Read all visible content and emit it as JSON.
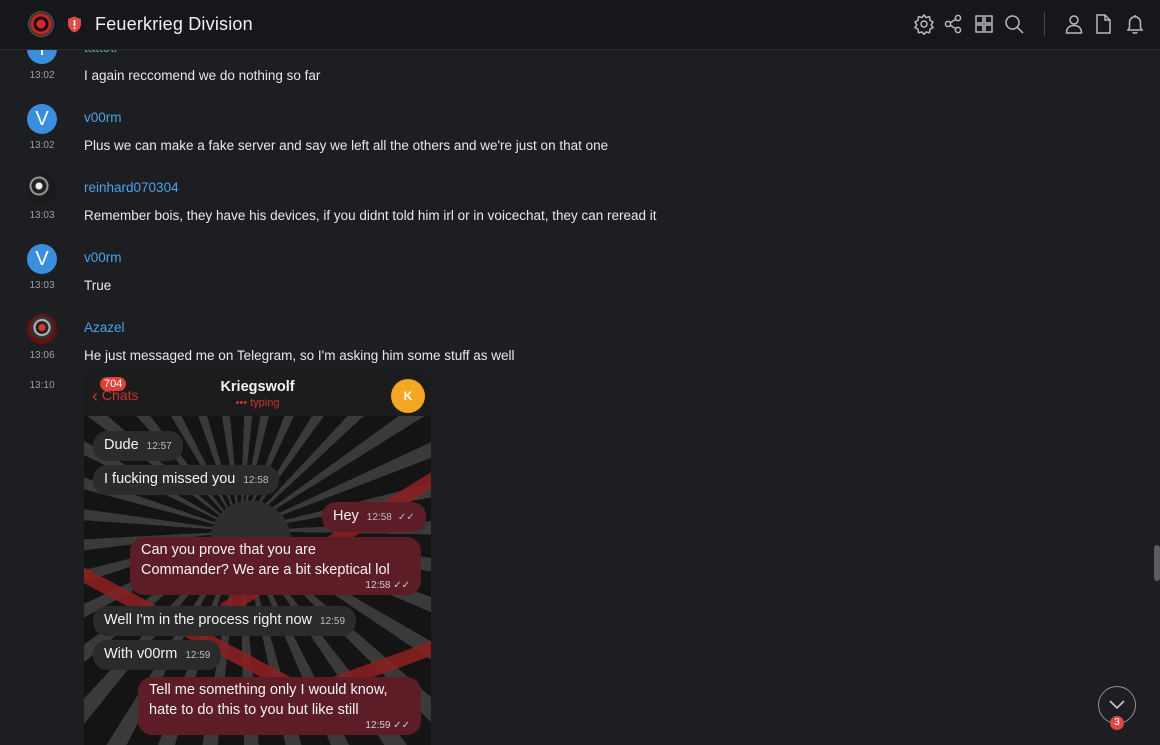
{
  "header": {
    "server_name": "Feuerkrieg Division"
  },
  "icons": {
    "server": "server-avatar-icon",
    "badge": "shield-alert-icon",
    "settings": "gear-icon",
    "share": "share-icon",
    "grid": "grid-icon",
    "search": "search-icon",
    "members": "user-icon",
    "files": "file-icon",
    "notifications": "bell-icon",
    "scroll_down": "chevron-down-icon"
  },
  "messages": [
    {
      "author": "tattoti",
      "avatar": "T",
      "time": "13:02",
      "text": "I again reccomend we do nothing so far"
    },
    {
      "author": "v00rm",
      "avatar": "V",
      "time": "13:02",
      "text": "Plus we can make a fake server and say we left all the others and we're just on that one"
    },
    {
      "author": "reinhard070304",
      "avatar": "",
      "time": "13:03",
      "text": "Remember bois, they have his devices, if you didnt told him irl or in voicechat, they can reread it"
    },
    {
      "author": "v00rm",
      "avatar": "V",
      "time": "13:03",
      "text": "True"
    },
    {
      "author": "Azazel",
      "avatar": "",
      "time": "13:06",
      "text": "He just messaged me on Telegram, so I'm asking him some stuff as well"
    },
    {
      "author": "",
      "avatar": "",
      "time": "13:10",
      "text": ""
    }
  ],
  "attachment": {
    "back_label": "Chats",
    "unread_count": "704",
    "contact_name": "Kriegswolf",
    "status": "typing",
    "contact_initial": "K",
    "bubbles": [
      {
        "text": "Dude",
        "time": "12:57",
        "dir": "in"
      },
      {
        "text": "I fucking missed you",
        "time": "12:58",
        "dir": "in"
      },
      {
        "text": "Hey",
        "time": "12:58",
        "dir": "out"
      },
      {
        "text": "Can you prove that you are Commander? We are a bit skeptical lol",
        "line1": "Can you prove that you are",
        "line2": "Commander? We are a bit skeptical lol",
        "time": "12:58",
        "dir": "out"
      },
      {
        "text": "Well I'm in the process right now",
        "time": "12:59",
        "dir": "in"
      },
      {
        "text": "With v00rm",
        "time": "12:59",
        "dir": "in"
      },
      {
        "text": "Tell me something only I would know, hate to do this to you but like still",
        "line1": "Tell me something only I would know,",
        "line2": "hate to do this to you but like still",
        "time": "12:59",
        "dir": "out"
      }
    ]
  },
  "scroll": {
    "unread_badge": "3"
  },
  "colors": {
    "background": "#1d1e21",
    "author": "#4da3e8",
    "outgoing_bubble": "#5c1d27",
    "badge": "#e34545"
  }
}
